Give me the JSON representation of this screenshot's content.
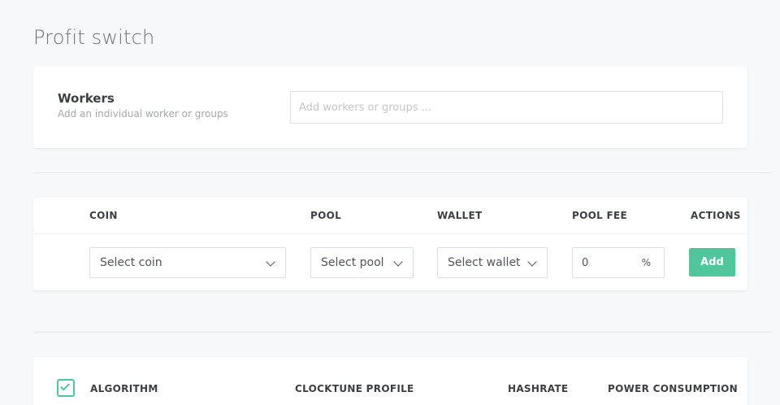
{
  "page": {
    "title": "Profit switch"
  },
  "workers": {
    "title": "Workers",
    "subtitle": "Add an individual worker or groups",
    "placeholder": "Add workers or groups ..."
  },
  "coin_table": {
    "headers": {
      "coin": "COIN",
      "pool": "POOL",
      "wallet": "WALLET",
      "pool_fee": "POOL FEE",
      "actions": "ACTIONS"
    },
    "row": {
      "coin_select": "Select coin",
      "pool_select": "Select pool",
      "wallet_select": "Select wallet",
      "fee_value": "0",
      "fee_unit": "%",
      "add_label": "Add"
    }
  },
  "algo_table": {
    "select_all_checked": true,
    "headers": {
      "algorithm": "ALGORITHM",
      "clocktune_profile": "CLOCKTUNE PROFILE",
      "hashrate": "HASHRATE",
      "power_consumption": "POWER CONSUMPTION"
    }
  },
  "colors": {
    "accent": "#4fc79a",
    "background": "#f7f8fa",
    "card": "#ffffff"
  },
  "icons": {
    "dropdown": "chevron-down-icon",
    "checkbox": "check-icon"
  }
}
